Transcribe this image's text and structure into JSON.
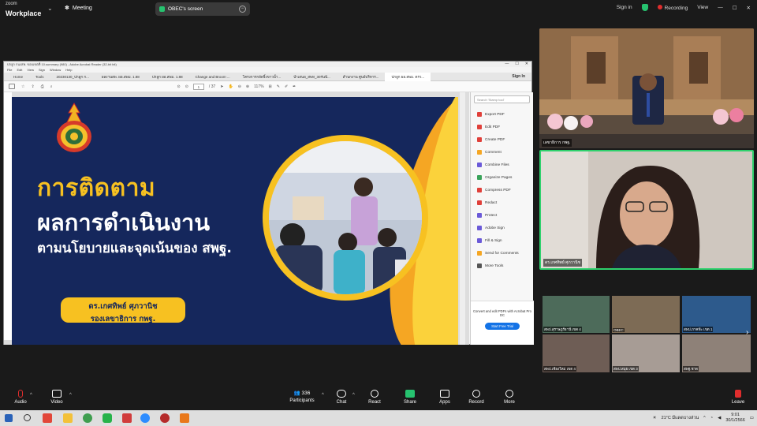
{
  "zoom": {
    "logo_small": "zoom",
    "logo_big": "Workplace",
    "meeting_label": "Meeting",
    "screen_label": "OBEC's screen",
    "sign_in": "Sign in",
    "recording": "Recording",
    "view": "View"
  },
  "pdf_window": {
    "title": "ปกลูก กนงสพ. ขอบเขตที่ 10.summary (980) - Adobe Acrobat Reader (32-bit bit)",
    "menu": [
      "File",
      "Edit",
      "View",
      "Sign",
      "Window",
      "Help"
    ],
    "tabs": [
      "Home",
      "Tools",
      "20230130_ปกลูก ก...",
      "ผลงานสพ. ผอ.สพม. 1.88",
      "ปกลูก ผอ.สพม. 1.88",
      "Change and Broom ...",
      "โครงการกลัดจิ้งขาวน้ำ...",
      "นำเสนอ_สพท_30ร่นนี...",
      "สำนกงาน ศูนย์บริหาร...",
      "ปกลูก ผอ.สพม. ตรว..."
    ],
    "sign_in": "Sign In",
    "page_current": "1",
    "page_total": "/ 37",
    "zoom_level": "117%"
  },
  "slide": {
    "title": "การติดตาม",
    "subtitle1": "ผลการดำเนินงาน",
    "subtitle2": "ตามนโยบายและจุดเน้นของ สพฐ.",
    "name_line1": "ดร.เกศทิพย์  ศุภวานิช",
    "name_line2": "รองเลขาธิการ กพฐ."
  },
  "acrobat": {
    "search_placeholder": "Search 'Stamp tool'",
    "items": [
      {
        "label": "Export PDF",
        "color": "#e0403a"
      },
      {
        "label": "Edit PDF",
        "color": "#e0403a"
      },
      {
        "label": "Create PDF",
        "color": "#e0403a"
      },
      {
        "label": "Comment",
        "color": "#f5a623"
      },
      {
        "label": "Combine Files",
        "color": "#6b5ad8"
      },
      {
        "label": "Organize Pages",
        "color": "#3aa35a"
      },
      {
        "label": "Compress PDF",
        "color": "#e0403a"
      },
      {
        "label": "Redact",
        "color": "#e0403a"
      },
      {
        "label": "Protect",
        "color": "#6b5ad8"
      },
      {
        "label": "Adobe Sign",
        "color": "#6b5ad8"
      },
      {
        "label": "Fill & Sign",
        "color": "#6b5ad8"
      },
      {
        "label": "Send for Comments",
        "color": "#f5a623"
      },
      {
        "label": "More Tools",
        "color": "#555555"
      }
    ],
    "footer_text": "Convert and edit PDFs with Acrobat Pro DC",
    "footer_button": "Start Free Trial"
  },
  "videos": {
    "top_label": "เลขาธิการ กพฐ.",
    "speaker_label": "ดร.เกศทิพย์ ศุภวานิช",
    "mini": [
      {
        "label": "สพป.สุราษฎร์ธานี เขต 4",
        "bg": "#4d6b5a"
      },
      {
        "label": "OBEC",
        "bg": "#7d6b55"
      },
      {
        "label": "สพป.ภาคฟ้ะ เขต 1",
        "bg": "#2d5a8c"
      },
      {
        "label": "สพป.เชียงใหม่ เขต 4",
        "bg": "#6e5d55"
      },
      {
        "label": "สพป.สมุย เขต 3",
        "bg": "#a79c95"
      },
      {
        "label": "สพฐ.ชาด",
        "bg": "#8e8178"
      }
    ]
  },
  "toolbar": {
    "audio": "Audio",
    "video": "Video",
    "participants": "Participants",
    "participants_count": "336",
    "chat": "Chat",
    "react": "React",
    "share": "Share",
    "apps": "Apps",
    "record": "Record",
    "more": "More",
    "leave": "Leave"
  },
  "taskbar": {
    "weather": "21°C มีแดดบางส่วน",
    "time": "9:01",
    "date": "30/1/2566"
  }
}
